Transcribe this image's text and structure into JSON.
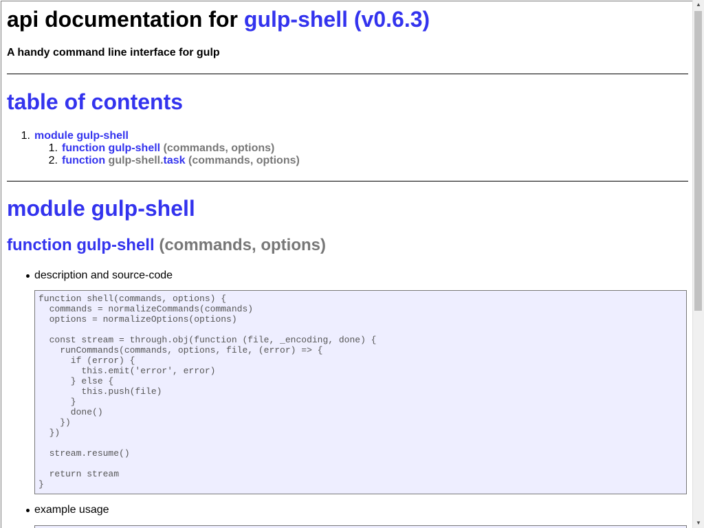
{
  "header": {
    "title_prefix": "api documentation for",
    "title_link": "gulp-shell (v0.6.3)",
    "subtitle": "A handy command line interface for gulp"
  },
  "toc": {
    "heading": "table of contents",
    "items": [
      {
        "number": "1.",
        "label": "module gulp-shell"
      }
    ],
    "subitems": [
      {
        "number": "1.",
        "keyword": "function",
        "name": "gulp-shell",
        "params": "(commands, options)"
      },
      {
        "number": "2.",
        "keyword": "function",
        "prefix": "gulp-shell.",
        "name": "task",
        "params": "(commands, options)"
      }
    ]
  },
  "module": {
    "heading": "module gulp-shell",
    "function_heading": {
      "keyword": "function",
      "name": "gulp-shell",
      "params": "(commands, options)"
    },
    "bullets": [
      {
        "label": "description and source-code"
      },
      {
        "label": "example usage"
      }
    ],
    "source_code": "function shell(commands, options) {\n  commands = normalizeCommands(commands)\n  options = normalizeOptions(options)\n\n  const stream = through.obj(function (file, _encoding, done) {\n    runCommands(commands, options, file, (error) => {\n      if (error) {\n        this.emit('error', error)\n      } else {\n        this.push(file)\n      }\n      done()\n    })\n  })\n\n  stream.resume()\n\n  return stream\n}"
  },
  "icons": {
    "scroll_up": "triangle-up",
    "scroll_down": "triangle-down"
  }
}
